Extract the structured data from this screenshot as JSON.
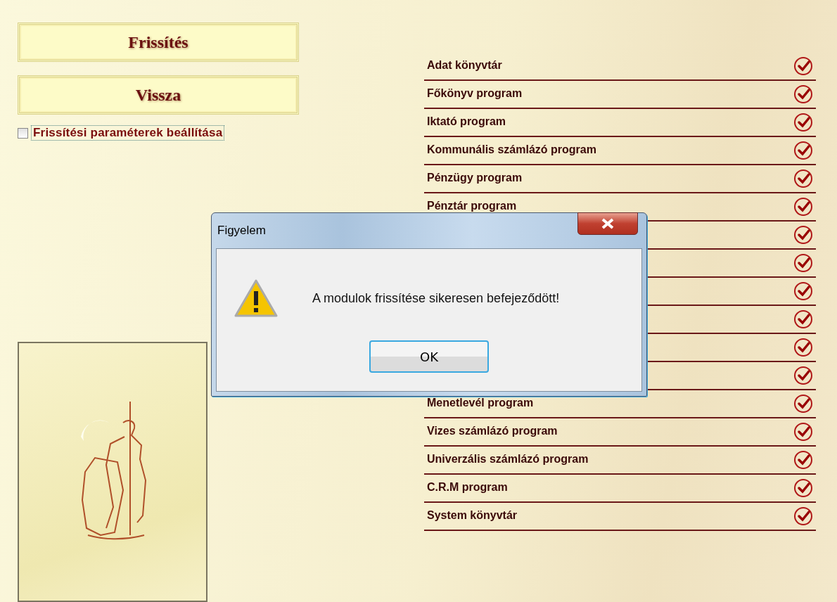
{
  "buttons": [
    {
      "label": "Frissítés"
    },
    {
      "label": "Vissza"
    }
  ],
  "settings_checkbox": {
    "label": "Frissítési paraméterek beállítása",
    "checked": false
  },
  "modules": [
    {
      "label": "Adat könyvtár",
      "checked": true
    },
    {
      "label": "Főkönyv program",
      "checked": true
    },
    {
      "label": "Iktató program",
      "checked": true
    },
    {
      "label": "Kommunális számlázó program",
      "checked": true
    },
    {
      "label": "Pénzügy program",
      "checked": true
    },
    {
      "label": "Pénztár program",
      "checked": true
    },
    {
      "checked": true
    },
    {
      "checked": true
    },
    {
      "checked": true
    },
    {
      "checked": true
    },
    {
      "checked": true
    },
    {
      "checked": true
    },
    {
      "label": "Menetlevél program",
      "checked": true
    },
    {
      "label": "Vizes számlázó program",
      "checked": true
    },
    {
      "label": "Univerzális számlázó program",
      "checked": true
    },
    {
      "label": "C.R.M program",
      "checked": true
    },
    {
      "label": "System könyvtár",
      "checked": true
    }
  ],
  "dialog": {
    "title": "Figyelem",
    "message": "A modulok frissítése sikeresen befejeződött!",
    "button": "OK"
  }
}
